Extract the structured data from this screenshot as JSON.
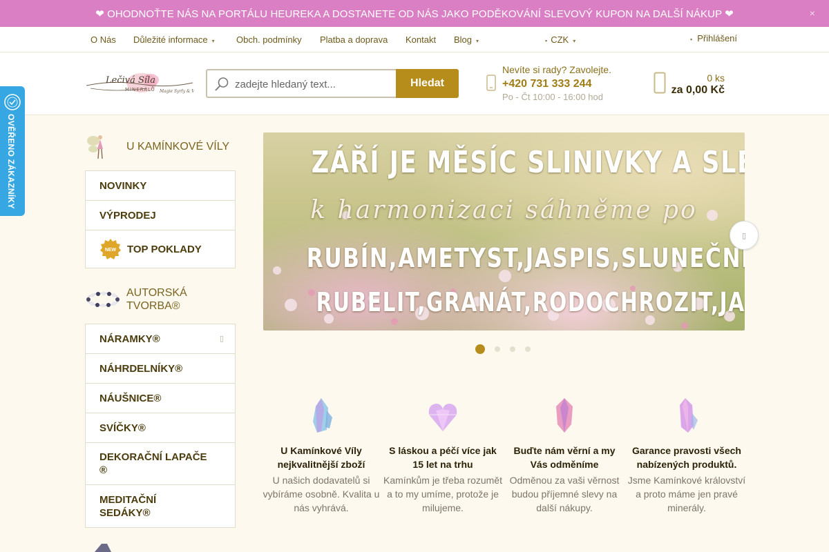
{
  "promo": {
    "text": "❤ OHODNOŤTE NÁS NA PORTÁLU HEUREKA A DOSTANETE OD NÁS JAKO PODĚKOVÁNÍ SLEVOVÝ KUPON NA DALŠÍ NÁKUP ❤",
    "close": "×"
  },
  "topnav": {
    "items": [
      "O Nás",
      "Důležité informace",
      "Obch. podmínky",
      "Platba a doprava",
      "Kontakt",
      "Blog"
    ],
    "currency": "CZK",
    "login": "Přihlášení"
  },
  "search": {
    "placeholder": "zadejte hledaný text...",
    "button": "Hledat"
  },
  "contact": {
    "question": "Nevíte si rady? Zavolejte.",
    "phone": "+420 731 333 244",
    "hours": "Po - Čt 10:00 - 16:00 hod"
  },
  "cart": {
    "count": "0 ks",
    "total": "za 0,00 Kč"
  },
  "sidebar": {
    "section1": "U KAMÍNKOVÉ VÍLY",
    "menu1": [
      "NOVINKY",
      "VÝPRODEJ",
      "TOP POKLADY"
    ],
    "new_badge": "NEW",
    "section2": "AUTORSKÁ TVORBA®",
    "menu2": [
      "NÁRAMKY®",
      "NÁHRDELNÍKY®",
      "NÁUŠNICE®",
      "SVÍČKY®",
      "DEKORAČNÍ LAPAČE ®",
      "MEDITAČNÍ SEDÁKY®"
    ]
  },
  "verified_badge": {
    "text": "OVĚŘENO ZÁKAZNÍKY"
  },
  "banner": {
    "line1": "ZÁŘÍ JE MĚSÍC SLINIVKY A SLEZINY",
    "line2": "k harmonizaci sáhněme po",
    "line3": "RUBÍN,AMETYST,JASPIS,SLUNEČNÍ KÁMEN",
    "line4": "RUBELIT,GRANÁT,RODOCHROZIT,JADEIT,OLIVÍN"
  },
  "slider": {
    "active": 1,
    "count": 4
  },
  "benefits": [
    {
      "title": "U Kamínkové Víly nejkvalitnější zboží",
      "desc": "U našich dodavatelů si vybíráme osobně. Kvalita u nás vyhrává."
    },
    {
      "title": "S láskou a péčí více jak 15 let na trhu",
      "desc": "Kamínkům je třeba rozumět a to my umíme, protože je milujeme."
    },
    {
      "title": "Buďte nám věrní a my Vás odměníme",
      "desc": "Odměnou za vaši věrnost budou příjemné slevy na další nákupy."
    },
    {
      "title": "Garance pravosti všech nabízených produktů.",
      "desc": "Jsme Kamínkové království a proto máme jen pravé minerály."
    }
  ],
  "colors": {
    "promo": "#da7fc4",
    "accent": "#b68d1b",
    "verified": "#36a7e2"
  }
}
